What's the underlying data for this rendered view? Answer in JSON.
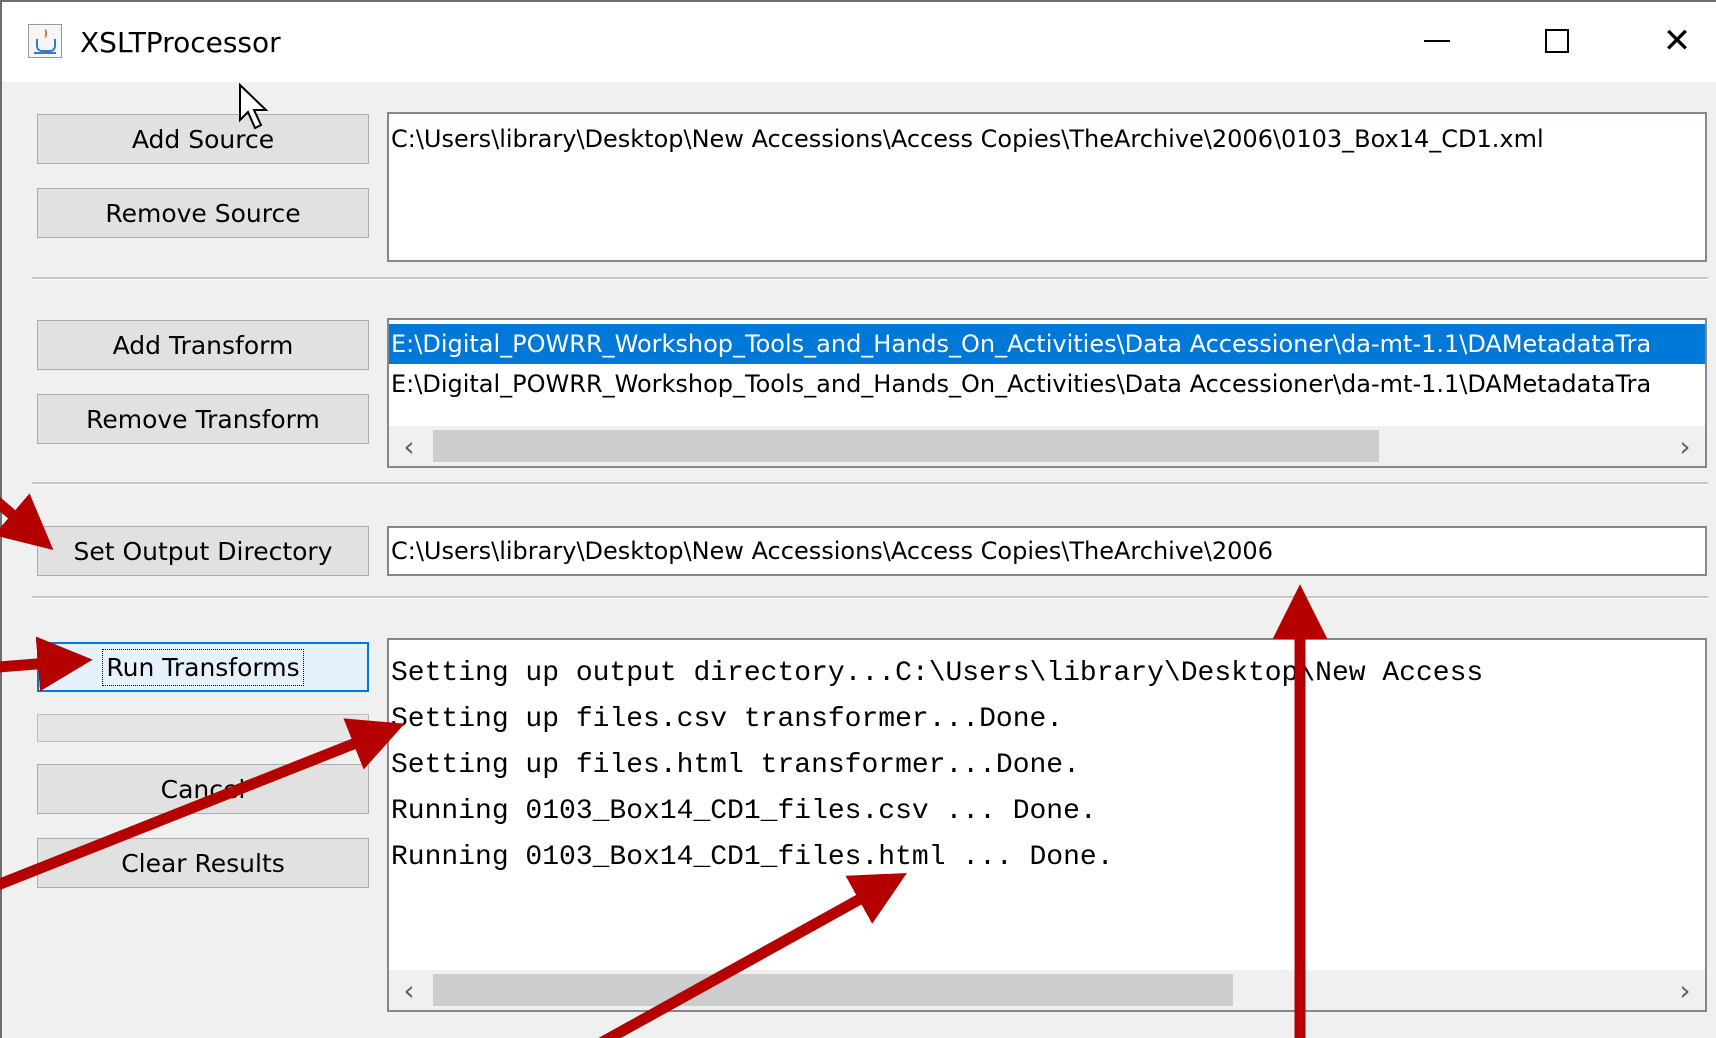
{
  "window": {
    "title": "XSLTProcessor",
    "icon": "java-icon"
  },
  "buttons": {
    "add_source": "Add Source",
    "remove_source": "Remove Source",
    "add_transform": "Add Transform",
    "remove_transform": "Remove Transform",
    "set_output": "Set Output Directory",
    "run": "Run Transforms",
    "cancel": "Cancel",
    "clear": "Clear Results"
  },
  "sources": [
    "C:\\Users\\library\\Desktop\\New Accessions\\Access Copies\\TheArchive\\2006\\0103_Box14_CD1.xml"
  ],
  "transforms": [
    "E:\\Digital_POWRR_Workshop_Tools_and_Hands_On_Activities\\Data Accessioner\\da-mt-1.1\\DAMetadataTra",
    "E:\\Digital_POWRR_Workshop_Tools_and_Hands_On_Activities\\Data Accessioner\\da-mt-1.1\\DAMetadataTra"
  ],
  "output_directory": "C:\\Users\\library\\Desktop\\New Accessions\\Access Copies\\TheArchive\\2006",
  "results": [
    "Setting up output directory...C:\\Users\\library\\Desktop\\New Access",
    "Setting up files.csv transformer...Done.",
    "Setting up files.html transformer...Done.",
    "Running 0103_Box14_CD1_files.csv ... Done.",
    "Running 0103_Box14_CD1_files.html ... Done."
  ],
  "colors": {
    "selection": "#0078d7",
    "annotation_arrow": "#b50000"
  }
}
